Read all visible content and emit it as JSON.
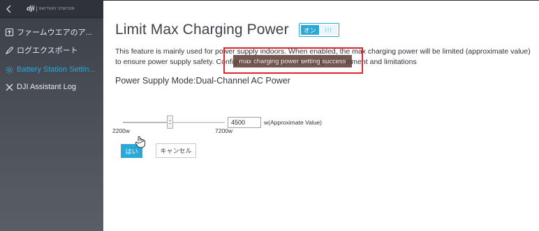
{
  "sidebar": {
    "brand_logo": "dji",
    "brand_text": "BATTERY STATION",
    "items": [
      {
        "label": "ファームウエアのア...",
        "icon": "firmware-icon"
      },
      {
        "label": "ログエクスポート",
        "icon": "rocket-icon"
      },
      {
        "label": "Battery Station Settin...",
        "icon": "settings-icon",
        "active": true
      },
      {
        "label": "DJI Assistant Log",
        "icon": "tools-icon"
      }
    ]
  },
  "main": {
    "title": "Limit Max Charging Power",
    "toggle": {
      "on_label": "オン",
      "off_label": "III",
      "state": "on"
    },
    "description": "This feature is mainly used for power supply indoors. When enabled, the max charging power will be limited (approximate value) to ensure power supply safety. Configure based on power supply environment and limitations",
    "toast": "max charging power setting success",
    "mode_label": "Power Supply Mode:Dual-Channel AC Power",
    "slider": {
      "min_label": "2200w",
      "max_label": "7200w",
      "value": 4500,
      "min": 2200,
      "max": 7200
    },
    "input_value": "4500",
    "unit_label": "w(Approximate Value)",
    "confirm_label": "はい",
    "cancel_label": "キャンセル"
  },
  "colors": {
    "accent": "#2aa8d8",
    "sidebar_bg": "#3f434c",
    "highlight": "#e0222a",
    "toast_bg": "#5a3a32"
  }
}
